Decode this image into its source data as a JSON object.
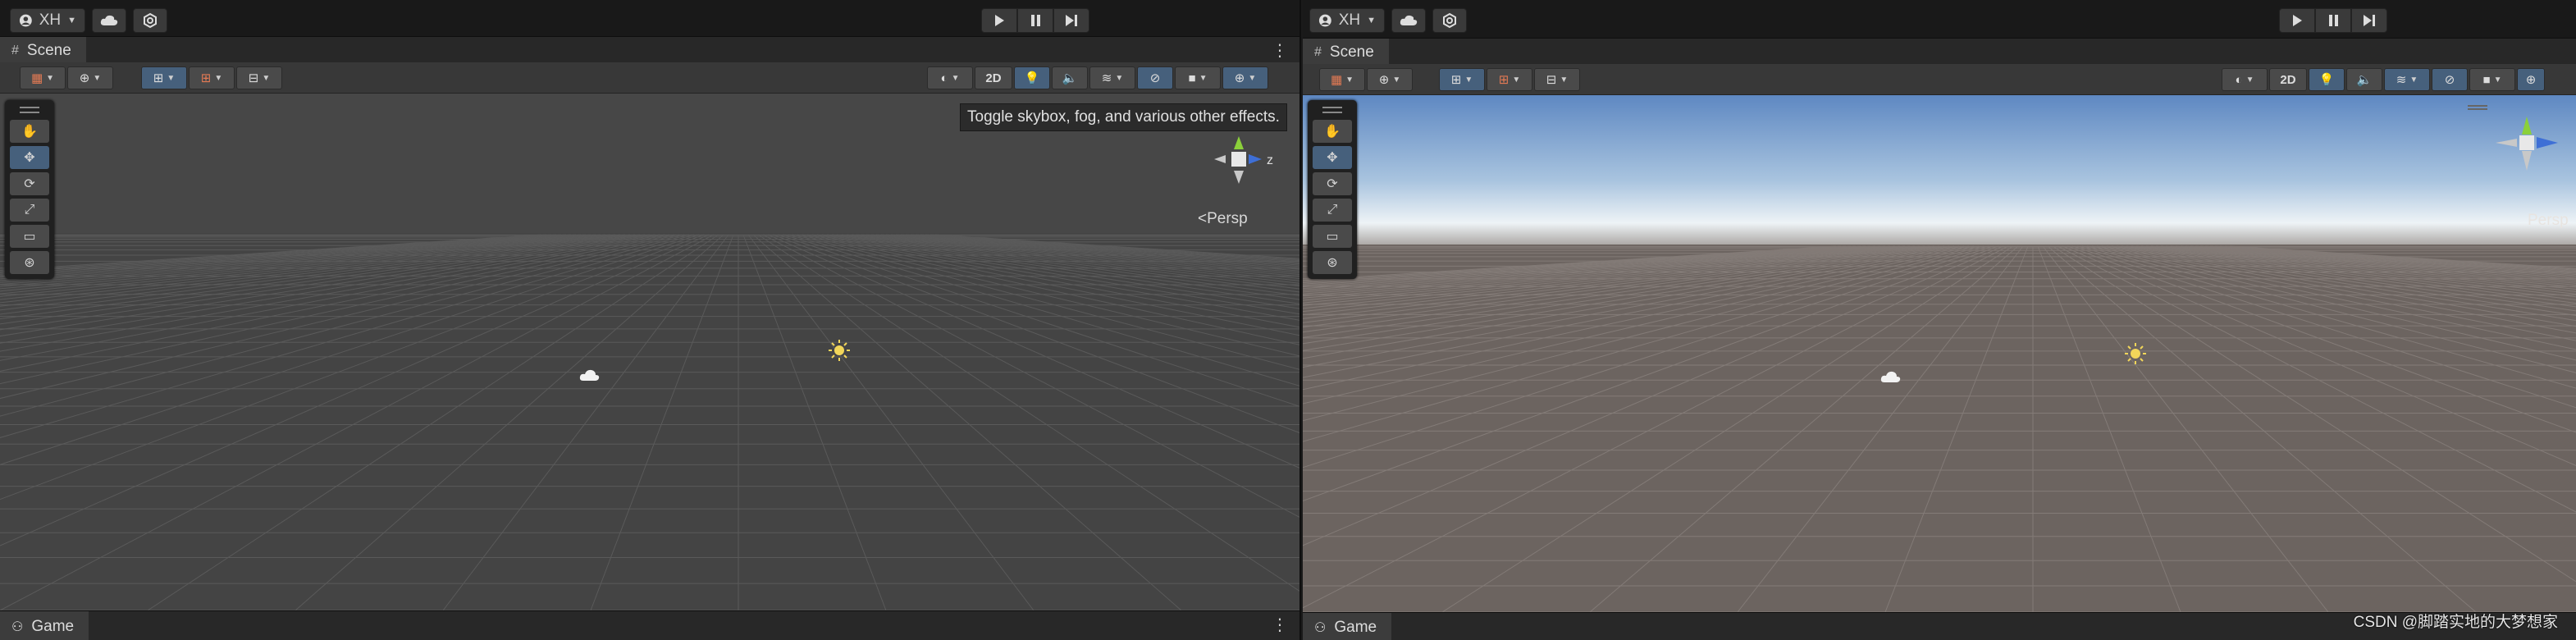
{
  "left": {
    "account": {
      "label": "XH"
    },
    "tab_scene": {
      "label": "Scene"
    },
    "toolbar": {
      "btn_2d": "2D"
    },
    "tooltip": "Toggle skybox, fog, and various other effects.",
    "gizmo": {
      "axis_label": "z",
      "persp_label": "Persp"
    },
    "tab_game": {
      "label": "Game"
    }
  },
  "right": {
    "account": {
      "label": "XH"
    },
    "tab_scene": {
      "label": "Scene"
    },
    "toolbar": {
      "btn_2d": "2D"
    },
    "gizmo": {
      "persp_label": "Persp"
    },
    "tab_game": {
      "label": "Game"
    },
    "watermark": "CSDN @脚踏实地的大梦想家"
  },
  "icons": [
    "account-icon",
    "cloud-icon",
    "services-icon",
    "play-icon",
    "pause-icon",
    "step-icon",
    "hand-tool-icon",
    "move-tool-icon",
    "rotate-tool-icon",
    "scale-tool-icon",
    "rect-tool-icon",
    "transform-tool-icon",
    "lighting-icon",
    "audio-icon",
    "effects-icon",
    "visibility-icon",
    "camera-icon",
    "gizmos-icon",
    "sun-icon",
    "cloud-skybox-icon"
  ],
  "colors": {
    "accent_blue": "#46607c",
    "left_ground": "#444444",
    "right_ground": "#6c6460",
    "sky_top": "#5e88c2"
  }
}
